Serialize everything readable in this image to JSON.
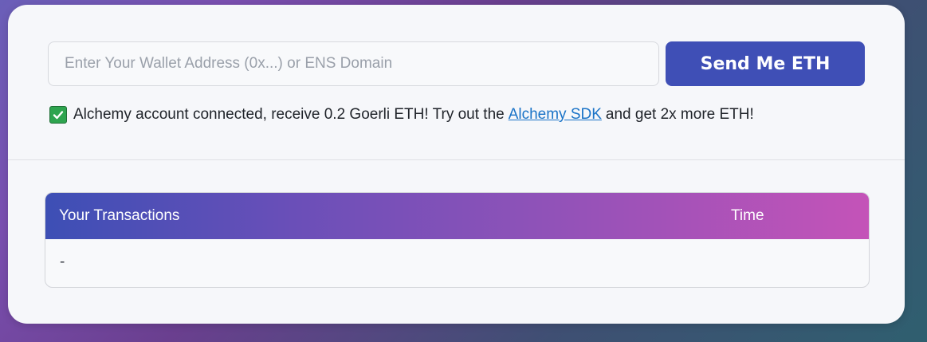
{
  "faucet": {
    "address_input": {
      "value": "",
      "placeholder": "Enter Your Wallet Address (0x...) or ENS Domain"
    },
    "send_button_label": "Send Me ETH",
    "status": {
      "icon": "check-mark-icon",
      "text_before": "Alchemy account connected, receive 0.2 Goerli ETH! Try out the",
      "link_text": "Alchemy SDK",
      "text_after": "and get 2x more ETH!"
    }
  },
  "transactions": {
    "columns": [
      "Your Transactions",
      "Time"
    ],
    "rows": [
      {
        "transaction": "-",
        "time": ""
      }
    ]
  },
  "colors": {
    "button": "#3f4fb6",
    "header_gradient_start": "#3d4fb5",
    "header_gradient_end": "#c453b8",
    "link": "#1a73c7",
    "check": "#2ea44f"
  }
}
